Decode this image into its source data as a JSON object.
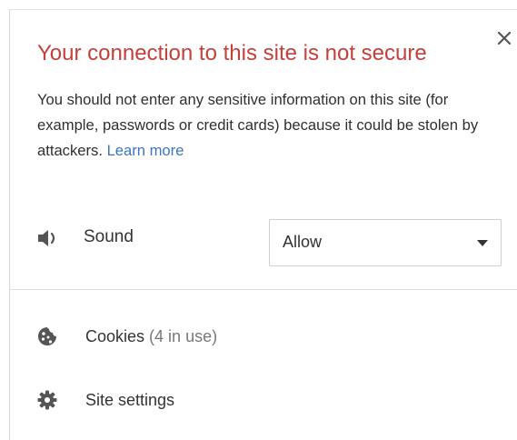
{
  "popup": {
    "title": "Your connection to this site is not secure",
    "message": "You should not enter any sensitive information on this site (for example, passwords or credit cards) because it could be stolen by attackers.",
    "learn_more": "Learn more",
    "close_icon": "close-icon"
  },
  "permissions": {
    "sound": {
      "label": "Sound",
      "icon": "speaker-icon",
      "value": "Allow"
    }
  },
  "menu": {
    "cookies": {
      "label": "Cookies",
      "count": "(4 in use)",
      "icon": "cookie-icon"
    },
    "site_settings": {
      "label": "Site settings",
      "icon": "gear-icon"
    }
  },
  "colors": {
    "title": "#c5403a",
    "link": "#3a75c4",
    "text": "#333333",
    "icon": "#555555"
  }
}
